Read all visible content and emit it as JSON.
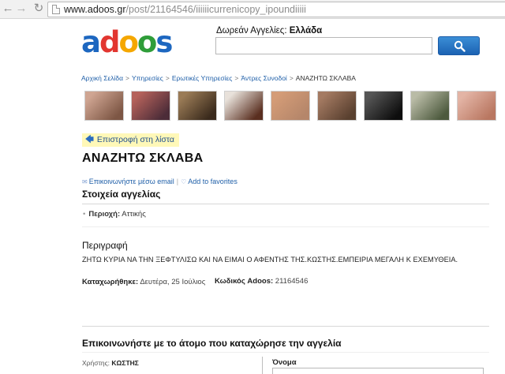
{
  "browser": {
    "url_host": "www.adoos.gr",
    "url_path": "/post/21164546/iiiiiicurrenicopy_ipoundiiiii"
  },
  "header": {
    "logo": [
      "a",
      "d",
      "o",
      "o",
      "s"
    ],
    "search_label": "Δωρεάν Αγγελίες:",
    "search_region": "Ελλάδα",
    "search_value": ""
  },
  "breadcrumb": [
    "Αρχική Σελίδα",
    "Υπηρεσίες",
    "Ερωτικές Υπηρεσίες",
    "Άντρες Συνοδοί",
    "ΑΝΑΖΗΤΩ ΣΚΛΑΒΑ"
  ],
  "breadcrumb_sep": ">",
  "thumbnails": [
    {
      "name": "thumb-1",
      "colors": [
        "#cfa592",
        "#7d5644"
      ]
    },
    {
      "name": "thumb-2",
      "colors": [
        "#b5625b",
        "#4c2c38"
      ]
    },
    {
      "name": "thumb-3",
      "colors": [
        "#9a7b56",
        "#3a2a1c"
      ]
    },
    {
      "name": "thumb-4",
      "colors": [
        "#e8e1da",
        "#5a2f20"
      ]
    },
    {
      "name": "thumb-5",
      "colors": [
        "#d49c77",
        "#b5866a"
      ]
    },
    {
      "name": "thumb-6",
      "colors": [
        "#a47a62",
        "#59402f"
      ]
    },
    {
      "name": "thumb-7",
      "colors": [
        "#555555",
        "#0d0d0d"
      ]
    },
    {
      "name": "thumb-8",
      "colors": [
        "#b9bba6",
        "#4d5a3e"
      ]
    },
    {
      "name": "thumb-9",
      "colors": [
        "#e3b4a5",
        "#b97761"
      ]
    }
  ],
  "ad": {
    "back_label": "Επιστροφή στη λίστα",
    "title": "ΑΝΑΖΗΤΩ ΣΚΛΑΒΑ",
    "email_action": "Επικοινωνήστε μέσω email",
    "favorites_action": "Add to favorites",
    "details_heading": "Στοιχεία αγγελίας",
    "region_key": "Περιοχή:",
    "region_value": "Αττικής",
    "description_heading": "Περιγραφή",
    "description": "ΖΗΤΩ ΚΥΡΙΑ ΝΑ ΤΗΝ ΞΕΦΤΥΛΙΣΩ ΚΑΙ ΝΑ ΕΙΜΑΙ Ο ΑΦΕΝΤΗΣ ΤΗΣ.ΚΩΣΤΗΣ.ΕΜΠΕΙΡΙΑ ΜΕΓΑΛΗ Κ ΕΧΕΜΥΘΕΙΑ.",
    "registered_key": "Καταχωρήθηκε:",
    "registered_value": "Δευτέρα, 25 Ιούλιος",
    "code_key": "Κωδικός Adoos:",
    "code_value": "21164546"
  },
  "contact": {
    "heading": "Επικοινωνήστε με το άτομο που καταχώρησε την αγγελία",
    "user_key": "Χρήστης:",
    "user_value": "ΚΩΣΤΗΣ",
    "name_label": "Όνομα"
  }
}
